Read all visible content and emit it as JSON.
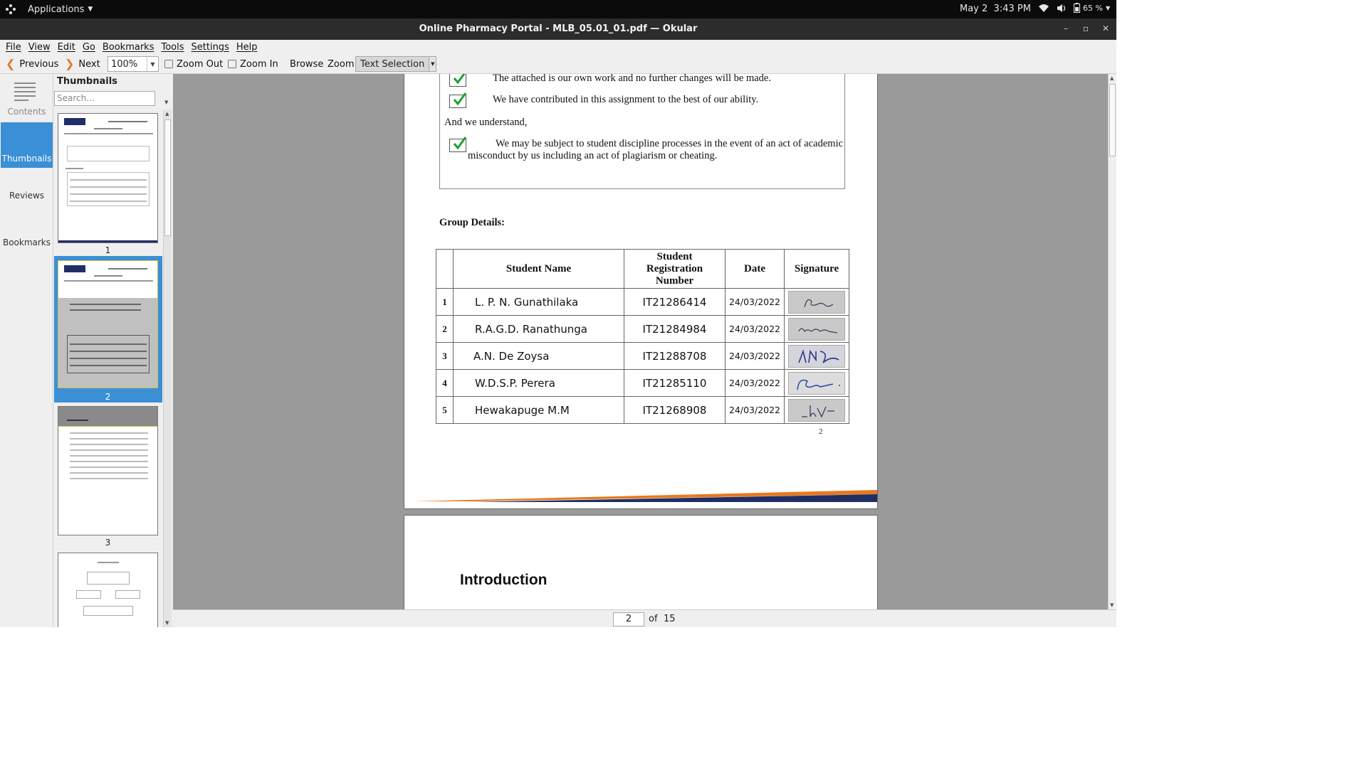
{
  "system_bar": {
    "applications_label": "Applications",
    "date": "May 2",
    "time": "3:43 PM",
    "battery": "65 %"
  },
  "window": {
    "title": "Online Pharmacy Portal - MLB_05.01_01.pdf  — Okular",
    "minimize": "–",
    "maximize": "▫",
    "close": "✕"
  },
  "menu": [
    "File",
    "View",
    "Edit",
    "Go",
    "Bookmarks",
    "Tools",
    "Settings",
    "Help"
  ],
  "toolbar": {
    "previous": "Previous",
    "next": "Next",
    "zoom_value": "100%",
    "zoom_out": "Zoom Out",
    "zoom_in": "Zoom In",
    "browse": "Browse",
    "zoom": "Zoom",
    "text_selection": "Text Selection"
  },
  "side_tabs": {
    "contents": "Contents",
    "thumbnails": "Thumbnails",
    "reviews": "Reviews",
    "bookmarks": "Bookmarks"
  },
  "thumbnails_panel": {
    "heading": "Thumbnails",
    "search_placeholder": "Search...",
    "pages": [
      "1",
      "2",
      "3"
    ]
  },
  "document": {
    "declaration_lines": [
      "The attached is our own work and no further changes will be made.",
      "We have contributed in this assignment to the best of our ability."
    ],
    "understand_label": "And we understand,",
    "misconduct_line1": "We may be subject to student discipline processes in the event of an act of academic",
    "misconduct_line2": "misconduct by us including an act of plagiarism or cheating.",
    "group_title": "Group Details:",
    "table_headers": {
      "name": "Student Name",
      "reg_1": "Student",
      "reg_2": "Registration",
      "reg_3": "Number",
      "date": "Date",
      "signature": "Signature"
    },
    "rows": [
      {
        "num": "1",
        "name": "L. P. N. Gunathilaka",
        "reg": "IT21286414",
        "date": "24/03/2022"
      },
      {
        "num": "2",
        "name": "R.A.G.D. Ranathunga",
        "reg": "IT21284984",
        "date": "24/03/2022"
      },
      {
        "num": "3",
        "name": "A.N. De Zoysa",
        "reg": "IT21288708",
        "date": "24/03/2022"
      },
      {
        "num": "4",
        "name": "W.D.S.P. Perera",
        "reg": "IT21285110",
        "date": "24/03/2022"
      },
      {
        "num": "5",
        "name": "Hewakapuge M.M",
        "reg": "IT21268908",
        "date": "24/03/2022"
      }
    ],
    "page_number": "2",
    "next_page_heading": "Introduction"
  },
  "pager": {
    "current": "2",
    "of_label": "of",
    "total": "15"
  },
  "colors": {
    "accent": "#3a8fd6",
    "nav_arrow": "#e07a2e",
    "check_green": "#1aa12b",
    "footer_orange": "#e8791e",
    "footer_navy": "#1f2f66"
  }
}
